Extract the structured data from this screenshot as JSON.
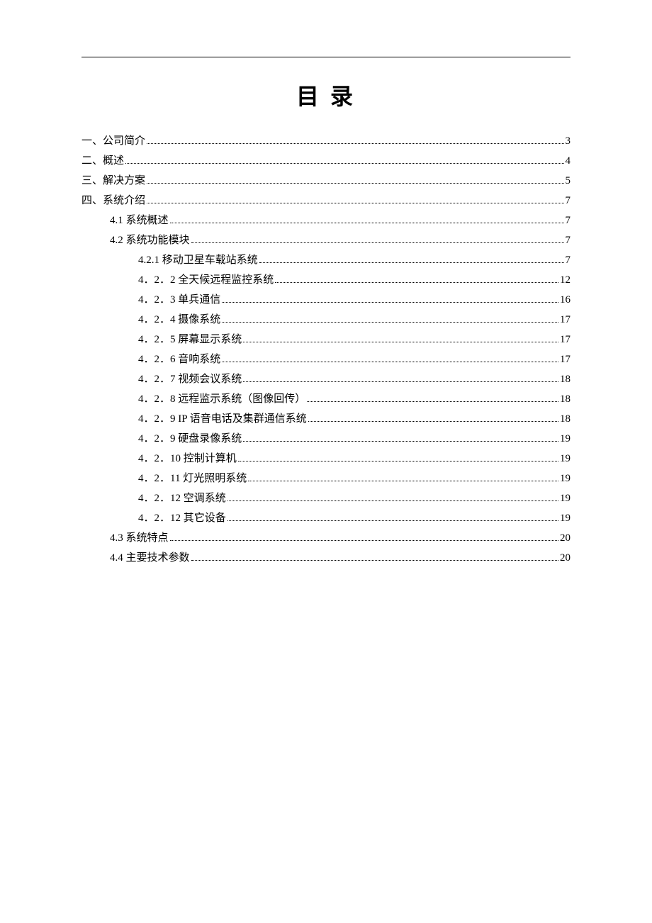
{
  "title": "目 录",
  "toc": [
    {
      "label": "一、公司简介",
      "page": "3",
      "indent": 0
    },
    {
      "label": "二、概述",
      "page": "4",
      "indent": 0
    },
    {
      "label": "三、解决方案",
      "page": "5",
      "indent": 0
    },
    {
      "label": "四、系统介绍",
      "page": "7",
      "indent": 0
    },
    {
      "label": "4.1  系统概述",
      "page": "7",
      "indent": 1
    },
    {
      "label": "4.2  系统功能模块",
      "page": "7",
      "indent": 1
    },
    {
      "label": "4.2.1  移动卫星车载站系统",
      "page": "7",
      "indent": 2
    },
    {
      "label": "4．2．2  全天候远程监控系统",
      "page": "12",
      "indent": 2
    },
    {
      "label": "4．2．3  单兵通信",
      "page": "16",
      "indent": 2
    },
    {
      "label": "4．2．4 摄像系统",
      "page": "17",
      "indent": 2
    },
    {
      "label": "4．2．5  屏幕显示系统",
      "page": "17",
      "indent": 2
    },
    {
      "label": "4．2．6 音响系统",
      "page": "17",
      "indent": 2
    },
    {
      "label": "4．2．7  视频会议系统",
      "page": "18",
      "indent": 2
    },
    {
      "label": "4．2．8  远程监示系统（图像回传）",
      "page": "18",
      "indent": 2
    },
    {
      "label": "4．2．9  IP 语音电话及集群通信系统",
      "page": "18",
      "indent": 2
    },
    {
      "label": "4．2．9  硬盘录像系统",
      "page": "19",
      "indent": 2
    },
    {
      "label": "4．2．10  控制计算机",
      "page": "19",
      "indent": 2
    },
    {
      "label": "4．2．11 灯光照明系统",
      "page": "19",
      "indent": 2
    },
    {
      "label": "4．2．12 空调系统",
      "page": "19",
      "indent": 2
    },
    {
      "label": "4．2．12 其它设备",
      "page": "19",
      "indent": 2
    },
    {
      "label": "4.3  系统特点",
      "page": "20",
      "indent": 1
    },
    {
      "label": "4.4 主要技术参数",
      "page": "20",
      "indent": 1
    }
  ]
}
